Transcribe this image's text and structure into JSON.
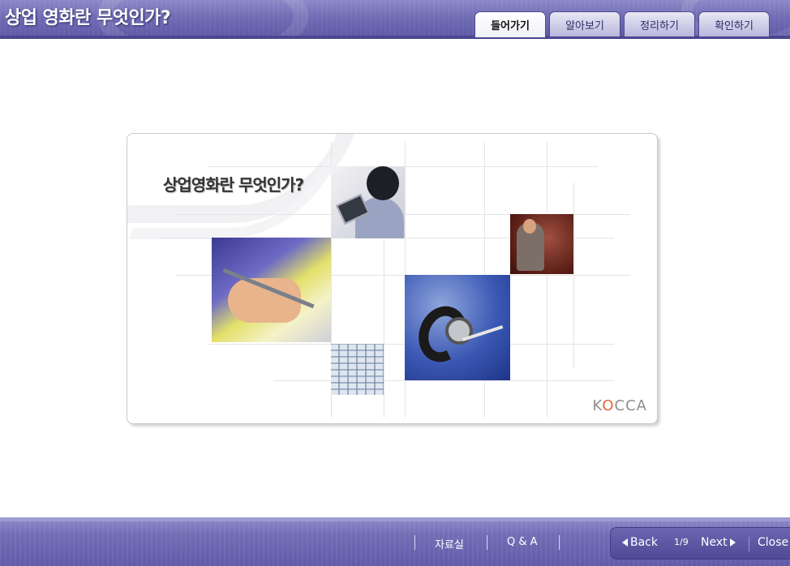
{
  "header": {
    "title": "상업 영화란 무엇인가?",
    "tabs": [
      {
        "label": "들어가기",
        "active": true
      },
      {
        "label": "알아보기",
        "active": false
      },
      {
        "label": "정리하기",
        "active": false
      },
      {
        "label": "확인하기",
        "active": false
      }
    ]
  },
  "content": {
    "panel_title": "상업영화란 무엇인가?",
    "logo_text": "KOCCA"
  },
  "footer": {
    "links": [
      "자료실",
      "Q & A"
    ],
    "nav": {
      "back_label": "Back",
      "page_current": "1",
      "page_total": "9",
      "page_indicator": "1/9",
      "next_label": "Next",
      "close_label": "Close"
    }
  },
  "colors": {
    "header_bar": "#6f6bb4",
    "footer_bar": "#716db6",
    "logo_accent": "#e5633a"
  }
}
